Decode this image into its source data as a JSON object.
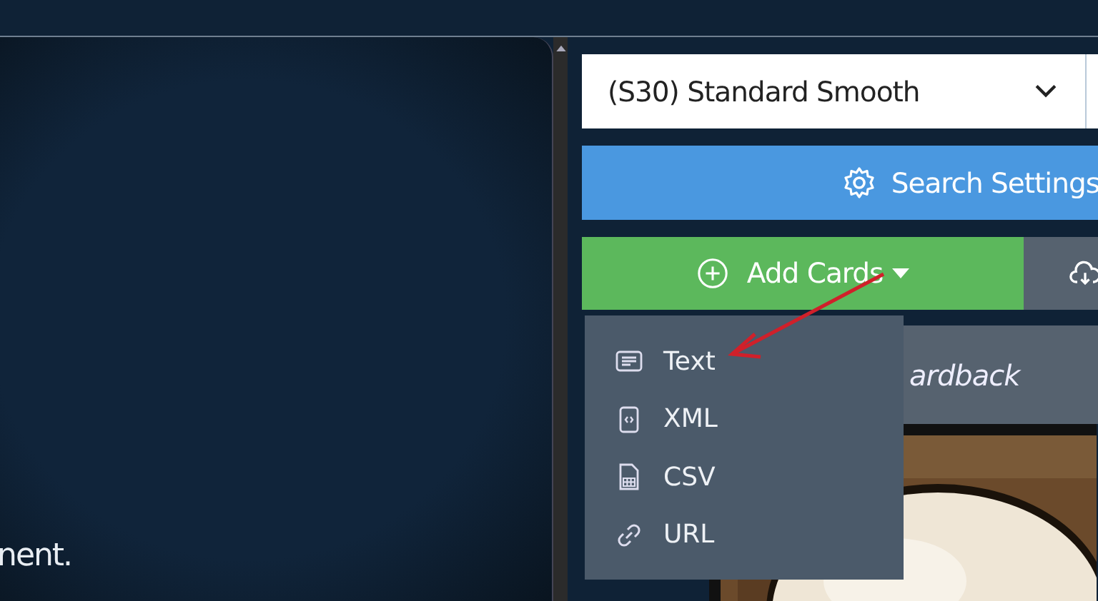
{
  "main_panel": {
    "text": "nent."
  },
  "toolbar": {
    "card_stock": {
      "value": "(S30) Standard Smooth"
    },
    "search_settings": {
      "label": "Search Settings"
    },
    "add_cards": {
      "label": "Add Cards",
      "expanded": true
    },
    "cardback": {
      "label": "ardback"
    }
  },
  "add_cards_menu": {
    "items": [
      {
        "label": "Text",
        "kind": "text"
      },
      {
        "label": "XML",
        "kind": "xml"
      },
      {
        "label": "CSV",
        "kind": "csv"
      },
      {
        "label": "URL",
        "kind": "url"
      }
    ]
  }
}
